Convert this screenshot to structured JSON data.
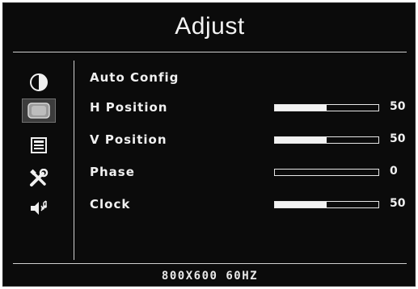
{
  "menu": {
    "title": "Adjust",
    "items": [
      {
        "label": "Auto Config"
      },
      {
        "label": "H Position",
        "value": "50",
        "level": 0.5
      },
      {
        "label": "V Position",
        "value": "50",
        "level": 0.5
      },
      {
        "label": "Phase",
        "value": "0",
        "level": 0.0
      },
      {
        "label": "Clock",
        "value": "50",
        "level": 0.5
      }
    ]
  },
  "sidebar": {
    "icons": [
      {
        "name": "contrast-icon"
      },
      {
        "name": "monitor-icon",
        "selected": true
      },
      {
        "name": "osd-menu-icon"
      },
      {
        "name": "tools-icon"
      },
      {
        "name": "speaker-icon"
      }
    ]
  },
  "status": {
    "resolution": "800X600  60HZ"
  }
}
